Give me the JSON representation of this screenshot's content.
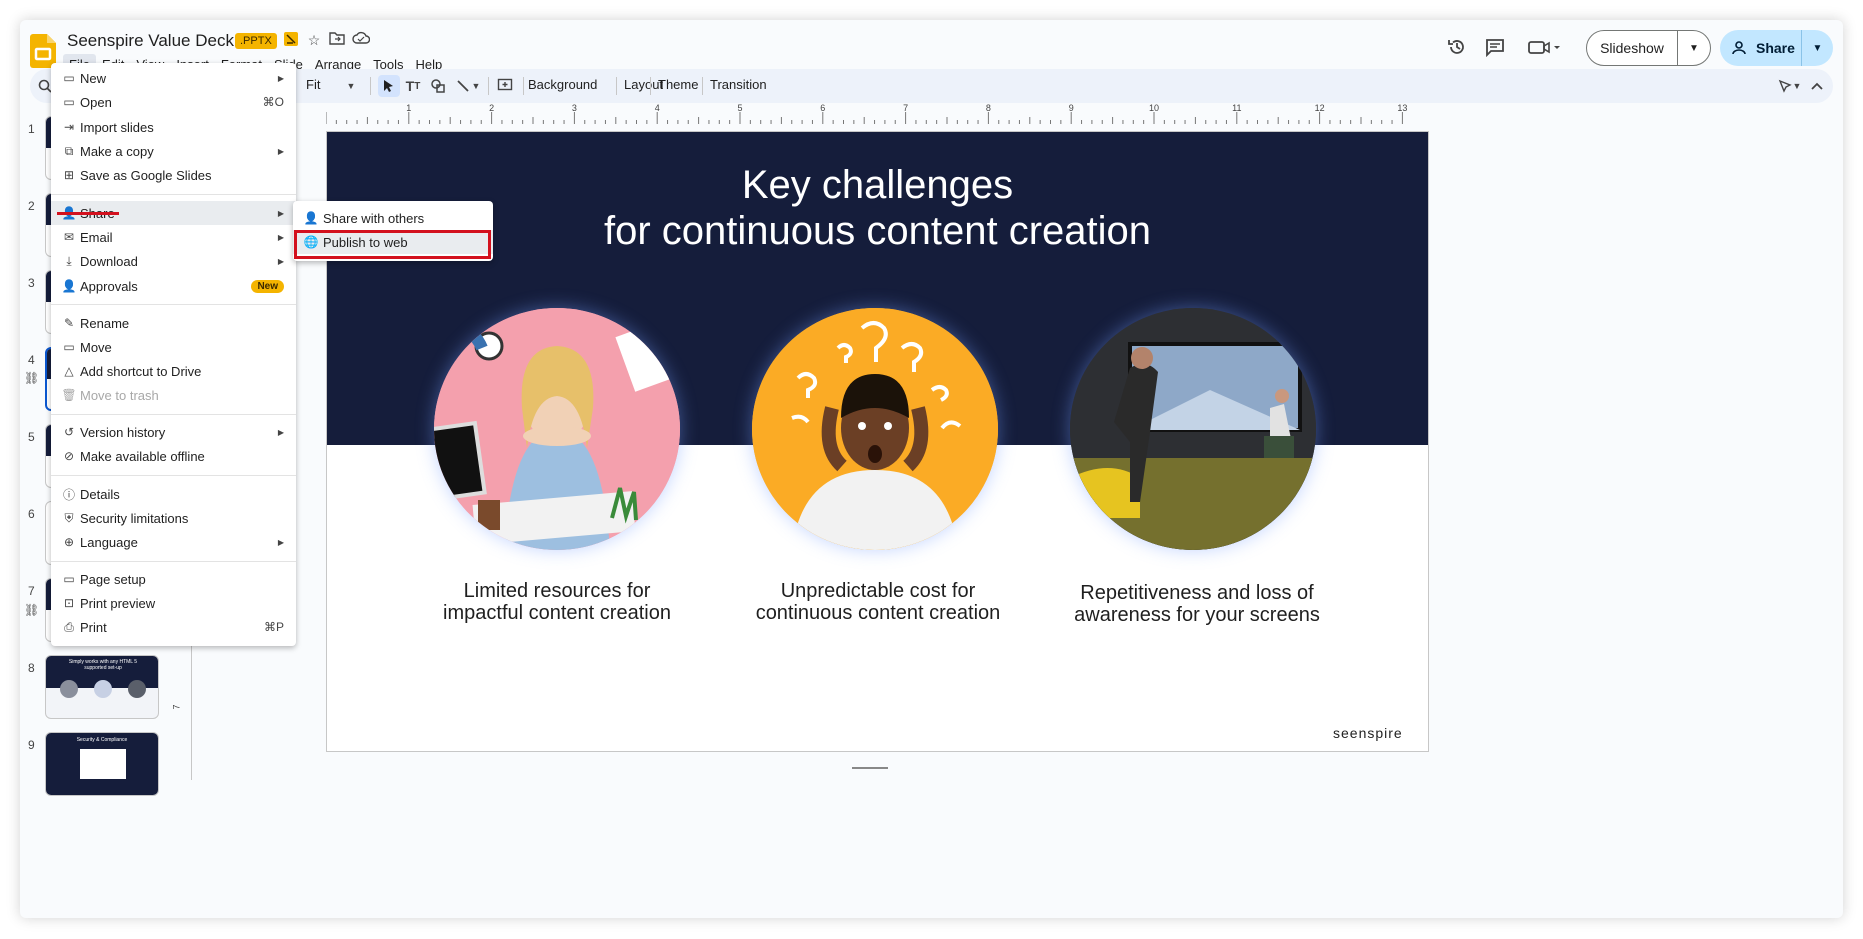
{
  "document": {
    "title": "Seenspire Value Deck",
    "format_badge": ".PPTX"
  },
  "menubar": [
    "File",
    "Edit",
    "View",
    "Insert",
    "Format",
    "Slide",
    "Arrange",
    "Tools",
    "Help"
  ],
  "header": {
    "slideshow_label": "Slideshow",
    "share_label": "Share"
  },
  "toolbar": {
    "zoom_value": "Fit",
    "background_label": "Background",
    "layout_label": "Layout",
    "theme_label": "Theme",
    "transition_label": "Transition"
  },
  "ruler_top": [
    "1",
    "2",
    "3",
    "4",
    "5",
    "6",
    "7",
    "8",
    "9",
    "10",
    "11",
    "12",
    "13"
  ],
  "ruler_left_label": "7",
  "filmstrip": {
    "numbers": [
      "1",
      "2",
      "3",
      "4",
      "5",
      "6",
      "7",
      "8",
      "9"
    ],
    "slide8_text": "Simply works with any HTML 5 supported set-up",
    "slide9_text": "Security & Compliance"
  },
  "slide": {
    "title_line1": "Key challenges",
    "title_line2": "for continuous content creation",
    "caption1_line1": "Limited resources for",
    "caption1_line2": "impactful content creation",
    "caption2_line1": "Unpredictable cost for",
    "caption2_line2": "continuous content creation",
    "caption3_line1": "Repetitiveness and loss of",
    "caption3_line2": "awareness for your screens",
    "brand": "seenspire"
  },
  "file_menu": {
    "new": "New",
    "open": "Open",
    "open_shortcut": "⌘O",
    "import_slides": "Import slides",
    "make_copy": "Make a copy",
    "save_google": "Save as Google Slides",
    "share": "Share",
    "email": "Email",
    "download": "Download",
    "approvals": "Approvals",
    "approvals_badge": "New",
    "rename": "Rename",
    "move": "Move",
    "add_shortcut": "Add shortcut to Drive",
    "move_trash": "Move to trash",
    "version_history": "Version history",
    "offline": "Make available offline",
    "details": "Details",
    "security": "Security limitations",
    "language": "Language",
    "page_setup": "Page setup",
    "print_preview": "Print preview",
    "print": "Print",
    "print_shortcut": "⌘P"
  },
  "share_submenu": {
    "share_others": "Share with others",
    "publish_web": "Publish to web"
  },
  "colors": {
    "slide_band": "#151d3b",
    "accent_red": "#d3111e",
    "share_button": "#c2e7ff",
    "badge_yellow": "#f4b400"
  }
}
